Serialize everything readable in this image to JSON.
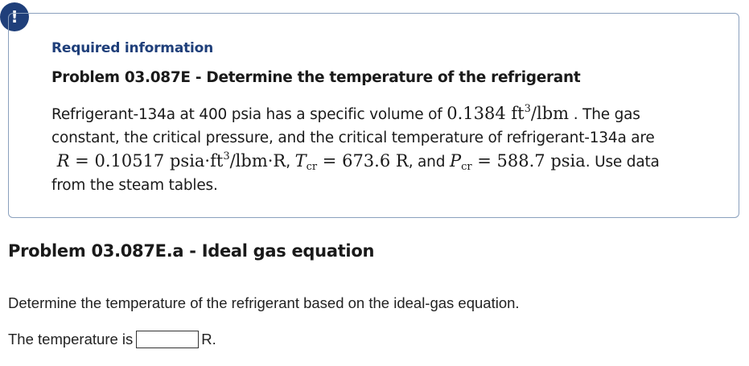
{
  "alert": {
    "icon": "exclamation-icon",
    "glyph": "!",
    "color": "#1f3f7a"
  },
  "info_box": {
    "heading": "Required information",
    "problem_title": "Problem 03.087E - Determine the temperature of the refrigerant",
    "text": {
      "p1": "Refrigerant-134a at 400 psia has a specific volume of",
      "v_value": "0.1384",
      "v_unit_base": "ft",
      "v_unit_sup": "3",
      "v_unit_rest": "/lbm",
      "p2": ". The gas constant, the critical pressure, and the critical temperature of refrigerant-134a are",
      "R_symbol": "R",
      "R_value": "0.10517 psia·ft",
      "R_sup": "3",
      "R_unit_rest": "/lbm·R",
      "sep1": ",",
      "T_symbol": "T",
      "T_sub": "cr",
      "T_value": "673.6 R",
      "sep2": ", and",
      "P_symbol": "P",
      "P_sub": "cr",
      "P_value": "588.7 psia",
      "p3": ". Use data from the steam tables."
    }
  },
  "part": {
    "title": "Problem 03.087E.a - Ideal gas equation",
    "question": "Determine the temperature of the refrigerant based on the ideal-gas equation.",
    "answer_label": "The temperature is",
    "answer_value": "",
    "answer_unit": "R."
  }
}
